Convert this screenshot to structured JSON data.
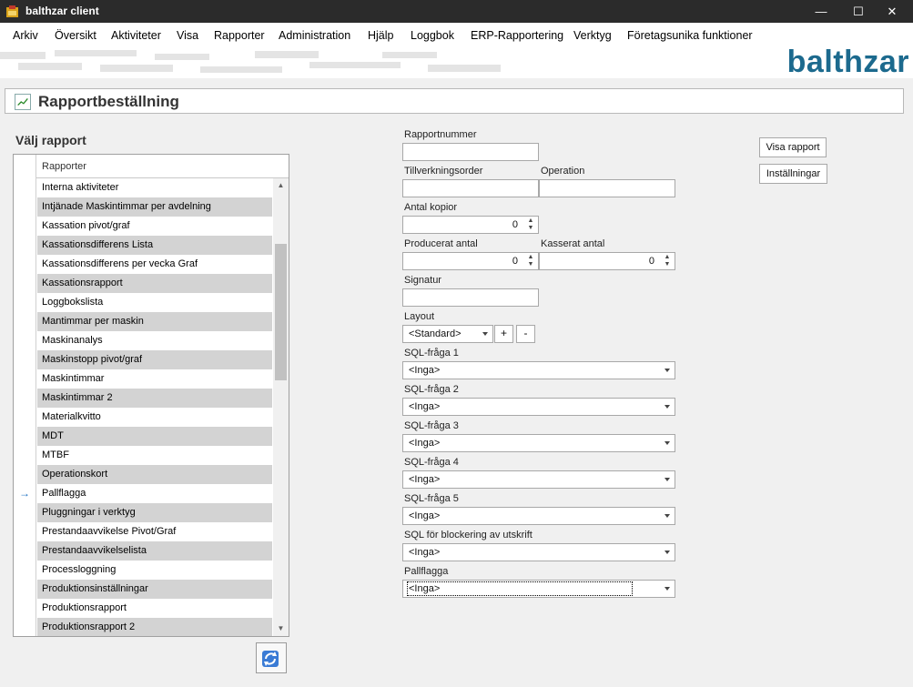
{
  "window": {
    "title": "balthzar client",
    "minimize": "—",
    "maximize": "☐",
    "close": "✕"
  },
  "menu": [
    "Arkiv",
    "Översikt",
    "Aktiviteter",
    "Visa",
    "Rapporter",
    "Administration",
    "Hjälp",
    "Loggbok",
    "ERP-Rapportering",
    "Verktyg",
    "Företagsunika funktioner"
  ],
  "banner": {
    "logo": "balthzar"
  },
  "header": {
    "title": "Rapportbeställning"
  },
  "left": {
    "section_title": "Välj rapport",
    "column_header": "Rapporter",
    "selected_index": 16,
    "selected_marker": "→",
    "rows": [
      "Interna aktiviteter",
      "Intjänade Maskintimmar per avdelning",
      "Kassation pivot/graf",
      "Kassationsdifferens Lista",
      "Kassationsdifferens per vecka Graf",
      "Kassationsrapport",
      "Loggbokslista",
      "Mantimmar per maskin",
      "Maskinanalys",
      "Maskinstopp pivot/graf",
      "Maskintimmar",
      "Maskintimmar 2",
      "Materialkvitto",
      "MDT",
      "MTBF",
      "Operationskort",
      "Pallflagga",
      "Pluggningar i verktyg",
      "Prestandaavvikelse Pivot/Graf",
      "Prestandaavvikelselista",
      "Processloggning",
      "Produktionsinställningar",
      "Produktionsrapport",
      "Produktionsrapport 2"
    ]
  },
  "form": {
    "rapportnummer": {
      "label": "Rapportnummer",
      "value": ""
    },
    "tillverkningsorder": {
      "label": "Tillverkningsorder",
      "value": ""
    },
    "operation": {
      "label": "Operation",
      "value": ""
    },
    "antal_kopior": {
      "label": "Antal kopior",
      "value": "0"
    },
    "producerat_antal": {
      "label": "Producerat antal",
      "value": "0"
    },
    "kasserat_antal": {
      "label": "Kasserat antal",
      "value": "0"
    },
    "signatur": {
      "label": "Signatur",
      "value": ""
    },
    "layout": {
      "label": "Layout",
      "value": "<Standard>",
      "add": "+",
      "remove": "-"
    },
    "combos": [
      {
        "label": "SQL-fråga 1",
        "value": "<Inga>"
      },
      {
        "label": "SQL-fråga 2",
        "value": "<Inga>"
      },
      {
        "label": "SQL-fråga 3",
        "value": "<Inga>"
      },
      {
        "label": "SQL-fråga 4",
        "value": "<Inga>"
      },
      {
        "label": "SQL-fråga 5",
        "value": "<Inga>"
      },
      {
        "label": "SQL för blockering av utskrift",
        "value": "<Inga>"
      },
      {
        "label": "Pallflagga",
        "value": "<Inga>"
      }
    ]
  },
  "buttons": {
    "visa_rapport": "Visa rapport",
    "installningar": "Inställningar"
  }
}
